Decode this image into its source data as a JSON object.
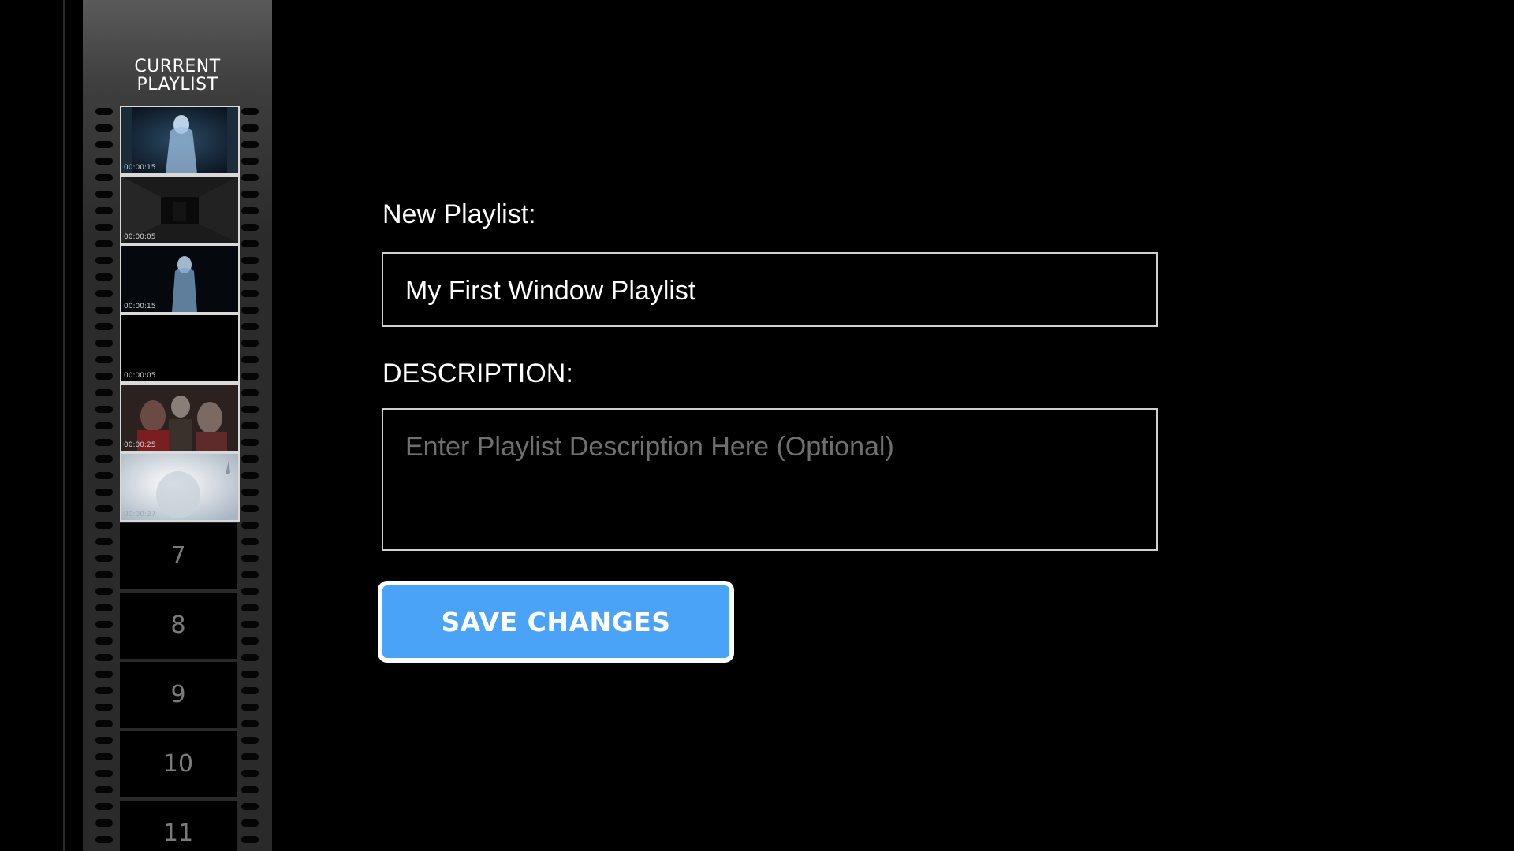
{
  "sidebar": {
    "title_line1": "CURRENT",
    "title_line2": "PLAYLIST",
    "items": [
      {
        "type": "thumb",
        "duration": "00:00:15",
        "scene": "ghost-bride"
      },
      {
        "type": "thumb",
        "duration": "00:00:05",
        "scene": "dark-hallway"
      },
      {
        "type": "thumb",
        "duration": "00:00:15",
        "scene": "ghost-figure"
      },
      {
        "type": "thumb",
        "duration": "00:00:05",
        "scene": "black"
      },
      {
        "type": "thumb",
        "duration": "00:00:25",
        "scene": "zombies"
      },
      {
        "type": "thumb",
        "duration": "00:00:27",
        "scene": "fog-hand"
      },
      {
        "type": "slot",
        "number": "7"
      },
      {
        "type": "slot",
        "number": "8"
      },
      {
        "type": "slot",
        "number": "9"
      },
      {
        "type": "slot",
        "number": "10"
      },
      {
        "type": "slot",
        "number": "11"
      }
    ]
  },
  "form": {
    "name_label": "New Playlist:",
    "name_value": "My First Window Playlist",
    "description_label": "DESCRIPTION:",
    "description_placeholder": "Enter Playlist Description Here (Optional)",
    "save_label": "SAVE CHANGES"
  },
  "colors": {
    "background": "#000000",
    "button": "#4aa3f7",
    "placeholder": "#6f6f6f"
  }
}
